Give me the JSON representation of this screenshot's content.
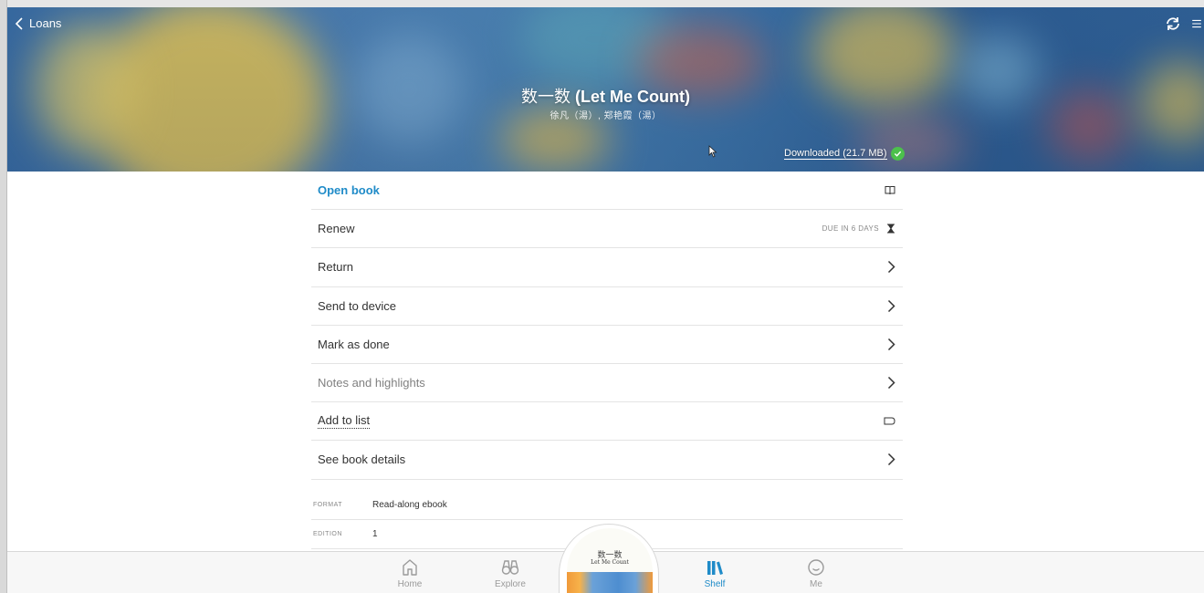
{
  "header": {
    "back_label": "Loans",
    "title_cn": "数一数",
    "title_en": "(Let Me Count)",
    "authors": "徐凡（湯）, 郑艳霞（湯）",
    "download_status": "Downloaded (21.7 MB)"
  },
  "menu": {
    "open_book": "Open book",
    "renew": "Renew",
    "due": "DUE IN 6 DAYS",
    "return": "Return",
    "send_to_device": "Send to device",
    "mark_as_done": "Mark as done",
    "notes_highlights": "Notes and highlights",
    "add_to_list": "Add to list",
    "see_details": "See book details"
  },
  "details": {
    "format_key": "FORMAT",
    "format_value": "Read-along ebook",
    "edition_key": "EDITION",
    "edition_value": "1"
  },
  "nav": {
    "home": "Home",
    "explore": "Explore",
    "shelf": "Shelf",
    "me": "Me",
    "active": "Shelf"
  },
  "cover": {
    "title_cn": "数一数",
    "title_en": "Let Me Count"
  },
  "colors": {
    "accent": "#1f8bc8",
    "check": "#4cc04c"
  },
  "icons": [
    "chevron-left-icon",
    "sync-icon",
    "menu-icon",
    "book-open-icon",
    "hourglass-icon",
    "chevron-right-icon",
    "tag-icon",
    "check-icon",
    "home-icon",
    "binoculars-icon",
    "books-icon",
    "smile-icon"
  ]
}
